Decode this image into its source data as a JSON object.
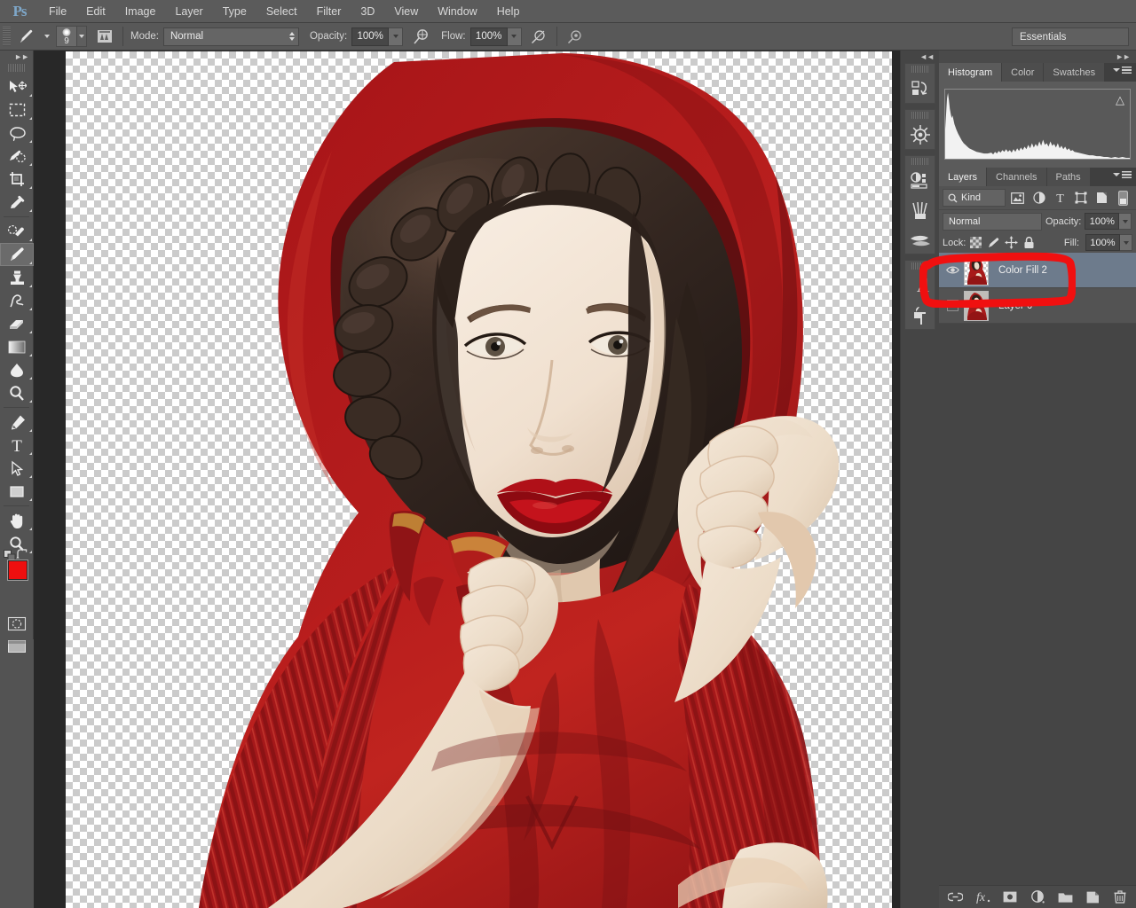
{
  "app": {
    "name": "Adobe Photoshop",
    "logo": "Ps"
  },
  "menubar": {
    "items": [
      "File",
      "Edit",
      "Image",
      "Layer",
      "Type",
      "Select",
      "Filter",
      "3D",
      "View",
      "Window",
      "Help"
    ]
  },
  "options_bar": {
    "tool_icon": "brush-icon",
    "brush_size": "9",
    "toggle_brush_panel_icon": "brush-panel-icon",
    "mode_label": "Mode:",
    "mode_value": "Normal",
    "opacity_label": "Opacity:",
    "opacity_value": "100%",
    "airbrush_icon": "airbrush-icon",
    "flow_label": "Flow:",
    "flow_value": "100%",
    "pressure_opacity_icon": "pressure-opacity-icon",
    "pressure_size_icon": "pressure-size-icon",
    "workspace": "Essentials"
  },
  "toolbar": {
    "collapse_icon": "double-chevron-right-icon",
    "tools": [
      {
        "name": "move-tool",
        "icon": "move-icon",
        "active": false
      },
      {
        "name": "rectangular-marquee-tool",
        "icon": "marquee-icon",
        "active": false
      },
      {
        "name": "lasso-tool",
        "icon": "lasso-icon",
        "active": false
      },
      {
        "name": "quick-selection-tool",
        "icon": "quick-select-icon",
        "active": false
      },
      {
        "name": "crop-tool",
        "icon": "crop-icon",
        "active": false
      },
      {
        "name": "eyedropper-tool",
        "icon": "eyedropper-icon",
        "active": false
      },
      {
        "name": "spot-healing-brush-tool",
        "icon": "healing-brush-icon",
        "active": false
      },
      {
        "name": "brush-tool",
        "icon": "brush-icon",
        "active": true
      },
      {
        "name": "clone-stamp-tool",
        "icon": "clone-stamp-icon",
        "active": false
      },
      {
        "name": "history-brush-tool",
        "icon": "history-brush-icon",
        "active": false
      },
      {
        "name": "eraser-tool",
        "icon": "eraser-icon",
        "active": false
      },
      {
        "name": "gradient-tool",
        "icon": "gradient-icon",
        "active": false
      },
      {
        "name": "blur-tool",
        "icon": "blur-drop-icon",
        "active": false
      },
      {
        "name": "dodge-tool",
        "icon": "dodge-icon",
        "active": false
      },
      {
        "name": "pen-tool",
        "icon": "pen-icon",
        "active": false
      },
      {
        "name": "horizontal-type-tool",
        "icon": "type-T-icon",
        "active": false
      },
      {
        "name": "path-selection-tool",
        "icon": "path-arrow-icon",
        "active": false
      },
      {
        "name": "rectangle-tool",
        "icon": "rectangle-shape-icon",
        "active": false
      },
      {
        "name": "hand-tool",
        "icon": "hand-icon",
        "active": false
      },
      {
        "name": "zoom-tool",
        "icon": "magnifier-icon",
        "active": false
      }
    ],
    "foreground_color": "#ee0f0f",
    "background_color": "#ffffff",
    "default_colors_icon": "default-colors-icon",
    "swap_colors_icon": "swap-colors-icon",
    "quick_mask_icon": "quick-mask-icon",
    "screen_mode_icon": "screen-mode-icon"
  },
  "icon_dock": {
    "collapse_icon": "double-chevron-left-icon",
    "groups": [
      {
        "items": [
          {
            "name": "history-panel-button",
            "icon": "history-icon"
          }
        ]
      },
      {
        "items": [
          {
            "name": "navigator-panel-button",
            "icon": "ship-wheel-icon"
          }
        ]
      },
      {
        "items": [
          {
            "name": "adjustments-panel-button",
            "icon": "adjustments-icon"
          },
          {
            "name": "brush-presets-panel-button",
            "icon": "brush-presets-icon"
          },
          {
            "name": "brush-panel-button",
            "icon": "brushes-icon"
          }
        ]
      },
      {
        "items": [
          {
            "name": "character-panel-button",
            "icon": "character-A-icon"
          },
          {
            "name": "paragraph-panel-button",
            "icon": "paragraph-pilcrow-icon"
          }
        ]
      }
    ]
  },
  "histogram_panel": {
    "tabs": [
      {
        "label": "Histogram",
        "active": true
      },
      {
        "label": "Color",
        "active": false
      },
      {
        "label": "Swatches",
        "active": false
      }
    ],
    "warning_icon": "cached-data-warning-icon",
    "menu_icon": "panel-menu-icon"
  },
  "layers_panel": {
    "tabs": [
      {
        "label": "Layers",
        "active": true
      },
      {
        "label": "Channels",
        "active": false
      },
      {
        "label": "Paths",
        "active": false
      }
    ],
    "menu_icon": "panel-menu-icon",
    "filter_label": "Kind",
    "filter_icons": [
      "pixel-filter-icon",
      "adjustment-filter-icon",
      "type-filter-icon",
      "shape-filter-icon",
      "smart-object-filter-icon",
      "filter-toggle-icon"
    ],
    "blend_mode": "Normal",
    "opacity_label": "Opacity:",
    "opacity_value": "100%",
    "lock_label": "Lock:",
    "lock_icons": [
      "lock-transparent-pixels-icon",
      "lock-image-pixels-icon",
      "lock-position-icon",
      "lock-all-icon"
    ],
    "fill_label": "Fill:",
    "fill_value": "100%",
    "layers": [
      {
        "name": "Color Fill 2",
        "visible": true,
        "selected": true,
        "thumbnail": "layer-thumbnail-color-fill"
      },
      {
        "name": "Layer 0",
        "visible": false,
        "selected": false,
        "thumbnail": "layer-thumbnail-layer0"
      }
    ],
    "footer_icons": [
      "link-layers-icon",
      "layer-style-fx-icon",
      "add-layer-mask-icon",
      "new-adjustment-layer-icon",
      "new-group-icon",
      "new-layer-icon",
      "delete-layer-icon"
    ]
  },
  "canvas": {
    "transparency_checker": true,
    "artwork_description": "woman-in-red-hooded-cloak"
  },
  "annotation": {
    "shape": "red-rectangle-highlight",
    "color": "#f01010",
    "target": "Color Fill 2"
  }
}
